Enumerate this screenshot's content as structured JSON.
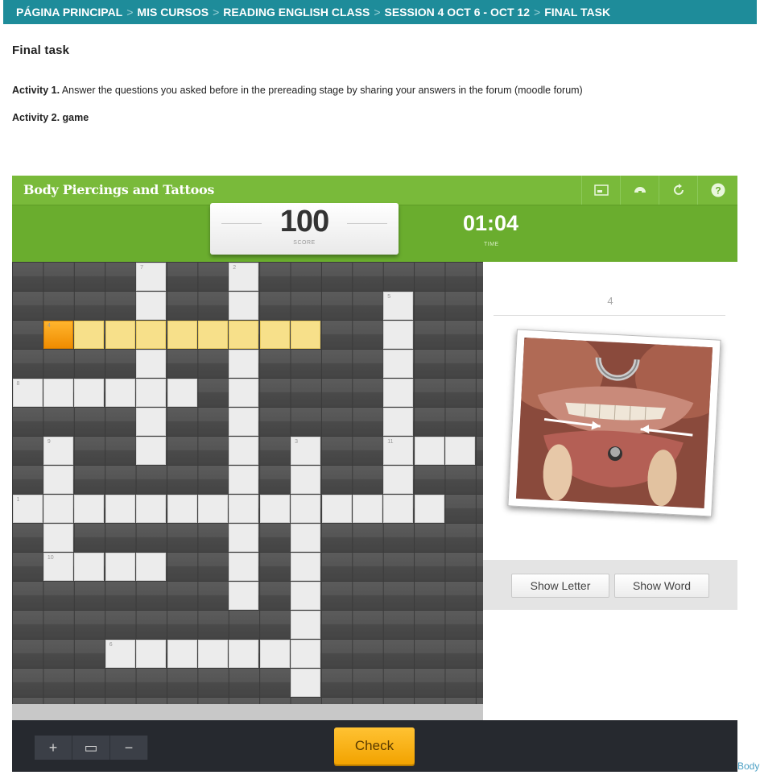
{
  "breadcrumb": [
    "PÁGINA PRINCIPAL",
    "MIS CURSOS",
    "READING ENGLISH CLASS",
    "SESSION 4 OCT 6 - OCT 12",
    "FINAL TASK"
  ],
  "breadcrumb_sep": ">",
  "page_title": "Final task",
  "activity1": {
    "label": "Activity 1.",
    "text": " Answer the questions you asked before in the prereading stage by sharing your answers in the forum (moodle forum)"
  },
  "activity2": {
    "label": "Activity 2. game"
  },
  "game": {
    "title": "Body Piercings and Tattoos",
    "toolbar_icons": [
      "screenshot-icon",
      "fullscreen-icon",
      "restart-icon",
      "help-icon"
    ],
    "score_value": "100",
    "score_label": "SCORE",
    "time_value": "01:04",
    "time_label": "TIME",
    "clue_number": "4",
    "show_letter": "Show Letter",
    "show_word": "Show Word",
    "check": "Check",
    "zoom_in": "+",
    "zoom_fit": "▭",
    "zoom_out": "−",
    "cells": [
      [
        4,
        0,
        "7"
      ],
      [
        7,
        0,
        "2"
      ],
      [
        4,
        1,
        ""
      ],
      [
        7,
        1,
        ""
      ],
      [
        12,
        1,
        "5"
      ],
      [
        1,
        2,
        "4",
        "act"
      ],
      [
        2,
        2,
        "",
        "hl"
      ],
      [
        3,
        2,
        "",
        "hl"
      ],
      [
        4,
        2,
        "",
        "hl"
      ],
      [
        5,
        2,
        "",
        "hl"
      ],
      [
        6,
        2,
        "",
        "hl"
      ],
      [
        7,
        2,
        "",
        "hl"
      ],
      [
        8,
        2,
        "",
        "hl"
      ],
      [
        9,
        2,
        "",
        "hl"
      ],
      [
        12,
        2,
        ""
      ],
      [
        4,
        3,
        ""
      ],
      [
        7,
        3,
        ""
      ],
      [
        12,
        3,
        ""
      ],
      [
        0,
        4,
        "8"
      ],
      [
        1,
        4,
        ""
      ],
      [
        2,
        4,
        ""
      ],
      [
        3,
        4,
        ""
      ],
      [
        4,
        4,
        ""
      ],
      [
        5,
        4,
        ""
      ],
      [
        7,
        4,
        ""
      ],
      [
        12,
        4,
        ""
      ],
      [
        4,
        5,
        ""
      ],
      [
        7,
        5,
        ""
      ],
      [
        12,
        5,
        ""
      ],
      [
        1,
        6,
        "9"
      ],
      [
        4,
        6,
        ""
      ],
      [
        7,
        6,
        ""
      ],
      [
        9,
        6,
        "3"
      ],
      [
        12,
        6,
        "11"
      ],
      [
        13,
        6,
        ""
      ],
      [
        14,
        6,
        ""
      ],
      [
        1,
        7,
        ""
      ],
      [
        7,
        7,
        ""
      ],
      [
        9,
        7,
        ""
      ],
      [
        12,
        7,
        ""
      ],
      [
        0,
        8,
        "1"
      ],
      [
        1,
        8,
        ""
      ],
      [
        2,
        8,
        ""
      ],
      [
        3,
        8,
        ""
      ],
      [
        4,
        8,
        ""
      ],
      [
        5,
        8,
        ""
      ],
      [
        6,
        8,
        ""
      ],
      [
        7,
        8,
        ""
      ],
      [
        8,
        8,
        ""
      ],
      [
        9,
        8,
        ""
      ],
      [
        10,
        8,
        ""
      ],
      [
        11,
        8,
        ""
      ],
      [
        12,
        8,
        ""
      ],
      [
        13,
        8,
        ""
      ],
      [
        1,
        9,
        ""
      ],
      [
        7,
        9,
        ""
      ],
      [
        9,
        9,
        ""
      ],
      [
        1,
        10,
        "10"
      ],
      [
        2,
        10,
        ""
      ],
      [
        3,
        10,
        ""
      ],
      [
        4,
        10,
        ""
      ],
      [
        7,
        10,
        ""
      ],
      [
        9,
        10,
        ""
      ],
      [
        7,
        11,
        ""
      ],
      [
        9,
        11,
        ""
      ],
      [
        9,
        12,
        ""
      ],
      [
        3,
        13,
        "6"
      ],
      [
        4,
        13,
        ""
      ],
      [
        5,
        13,
        ""
      ],
      [
        6,
        13,
        ""
      ],
      [
        7,
        13,
        ""
      ],
      [
        8,
        13,
        ""
      ],
      [
        9,
        13,
        ""
      ],
      [
        9,
        14,
        ""
      ]
    ]
  },
  "cut_text": "Body"
}
